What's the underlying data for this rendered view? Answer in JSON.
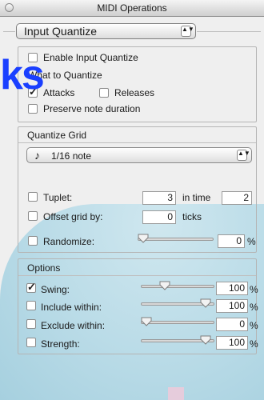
{
  "window": {
    "title": "MIDI Operations"
  },
  "operation_popup": {
    "label": "Input Quantize",
    "arrows": "▲▼"
  },
  "overlay_text": "ks",
  "enable": {
    "label": "Enable Input Quantize",
    "checked": false
  },
  "what_to_quantize": {
    "title": "What to Quantize",
    "attacks": {
      "label": "Attacks",
      "checked": true
    },
    "releases": {
      "label": "Releases",
      "checked": false
    },
    "preserve": {
      "label": "Preserve note duration",
      "checked": false
    }
  },
  "quantize_grid": {
    "title": "Quantize Grid",
    "grid_popup": {
      "icon_glyph": "♪",
      "label": "1/16 note",
      "arrows": "▲▼"
    },
    "tuplet": {
      "label": "Tuplet:",
      "checked": false,
      "value": "3",
      "in_time_label": "in time",
      "in_time_value": "2"
    },
    "offset": {
      "label": "Offset grid by:",
      "checked": false,
      "value": "0",
      "unit": "ticks"
    },
    "randomize": {
      "label": "Randomize:",
      "checked": false,
      "value": "0",
      "unit": "%",
      "level": 0
    }
  },
  "options": {
    "title": "Options",
    "items": [
      {
        "label": "Swing:",
        "checked": true,
        "value": "100",
        "unit": "%",
        "level": 0.3
      },
      {
        "label": "Include within:",
        "checked": false,
        "value": "100",
        "unit": "%",
        "level": 0.95
      },
      {
        "label": "Exclude within:",
        "checked": false,
        "value": "0",
        "unit": "%",
        "level": 0
      },
      {
        "label": "Strength:",
        "checked": false,
        "value": "100",
        "unit": "%",
        "level": 0.95
      }
    ]
  }
}
